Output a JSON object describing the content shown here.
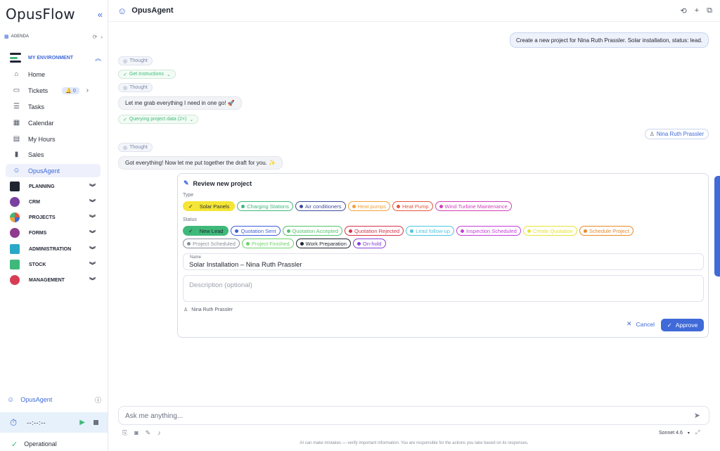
{
  "sidebar": {
    "logo": "OpusFlow",
    "collapse_icon": "«",
    "agenda": {
      "label": "AGENDA",
      "refresh": "⟳",
      "next": "›"
    },
    "environment": {
      "label": "MY ENVIRONMENT",
      "chevron": "⌃"
    },
    "nav": [
      {
        "label": "Home",
        "icon": "⌂"
      },
      {
        "label": "Tickets",
        "icon": "▭",
        "badge": "🔔 0",
        "arrow": "›"
      },
      {
        "label": "Tasks",
        "icon": "☰"
      },
      {
        "label": "Calendar",
        "icon": "▦"
      },
      {
        "label": "My Hours",
        "icon": "▤"
      },
      {
        "label": "Sales",
        "icon": "▮"
      },
      {
        "label": "OpusAgent",
        "icon": "☺"
      }
    ],
    "groups": [
      {
        "label": "PLANNING",
        "color": "#1f2430"
      },
      {
        "label": "CRM",
        "color": "#7b3fa0"
      },
      {
        "label": "PROJECTS",
        "color": "#e4573d"
      },
      {
        "label": "FORMS",
        "color": "#8e3b8e"
      },
      {
        "label": "ADMINISTRATION",
        "color": "#2aa8c7"
      },
      {
        "label": "STOCK",
        "color": "#3fb97a"
      },
      {
        "label": "MANAGEMENT",
        "color": "#d63d55"
      }
    ],
    "group_chevron": "»",
    "bottom_agent": {
      "label": "OpusAgent",
      "icon": "☺",
      "info": "ⓘ"
    },
    "timer": {
      "time": "--:--:--",
      "clock": "⏱",
      "play": "▶"
    },
    "status": {
      "label": "Operational",
      "icon": "✓"
    }
  },
  "header": {
    "title": "OpusAgent",
    "icons": {
      "history": "⟲",
      "add": "+",
      "copy": "⧉"
    },
    "bot_icon": "☺"
  },
  "chat": {
    "user_message": "Create a new project for Nina Ruth Prassler. Solar installation, status: lead.",
    "thought_label": "Thought",
    "thought_icon": "◎",
    "tool1": "Get Instructions",
    "tool2": "Querying project data (2×)",
    "tool_icon": "✓",
    "tool_chevron": "⌄",
    "msg1": "Let me grab everything I need in one go! 🚀",
    "mention": "Nina Ruth Prassler",
    "msg2": "Got everything! Now let me put together the draft for you. ✨"
  },
  "review": {
    "title": "Review new project",
    "type_label": "Type",
    "types": [
      {
        "label": "Solar Panels",
        "selected": true,
        "bg": "#f5e534",
        "fg": "#2b2f3a"
      },
      {
        "label": "Charging Stations",
        "color": "#3fb97a"
      },
      {
        "label": "Air conditioners",
        "color": "#3f4d9e"
      },
      {
        "label": "Heat pumps",
        "color": "#f0a23a"
      },
      {
        "label": "Heat Pump",
        "color": "#e4573d"
      },
      {
        "label": "Wind Turbine Maintenance",
        "color": "#d13fb9"
      }
    ],
    "status_label": "Status",
    "statuses_row1": [
      {
        "label": "New Lead",
        "selected": true,
        "bg": "#3fb97a",
        "fg": "#1f2430"
      },
      {
        "label": "Quotation Sent",
        "color": "#3f5fd8"
      },
      {
        "label": "Quotation Accepted",
        "color": "#54c270"
      },
      {
        "label": "Quotation Rejected",
        "color": "#d6334a"
      },
      {
        "label": "Lead follow-up",
        "color": "#4fc6e0"
      },
      {
        "label": "Inspection Scheduled",
        "color": "#c53fd8"
      },
      {
        "label": "Create Quotation",
        "color": "#e6e23a"
      },
      {
        "label": "Schedule Project",
        "color": "#e88a2a"
      }
    ],
    "statuses_row2": [
      {
        "label": "Project Scheduled",
        "color": "#8a8f9c"
      },
      {
        "label": "Project Finished",
        "color": "#6fd36c"
      },
      {
        "label": "Work Preparation",
        "color": "#1f2430"
      },
      {
        "label": "On-hold",
        "color": "#8a3fd8"
      }
    ],
    "check_icon": "✓",
    "name_label": "Name",
    "name_value": "Solar Installation – Nina Ruth Prassler",
    "description_placeholder": "Description (optional)",
    "owner": "Nina Ruth Prassler",
    "owner_icon": "♙",
    "edit_icon": "✎",
    "cancel_label": "Cancel",
    "cancel_icon": "✕",
    "approve_label": "Approve",
    "approve_icon": "✓"
  },
  "composer": {
    "placeholder": "Ask me anything...",
    "send_icon": "➤",
    "tool_icons": [
      "⎘",
      "◙",
      "✎",
      "♪"
    ],
    "model": "Sonnet 4.6",
    "model_chevron": "▾",
    "expand_icon": "⤢",
    "disclaimer": "AI can make mistakes — verify important information. You are responsible for the actions you take based on its responses."
  }
}
